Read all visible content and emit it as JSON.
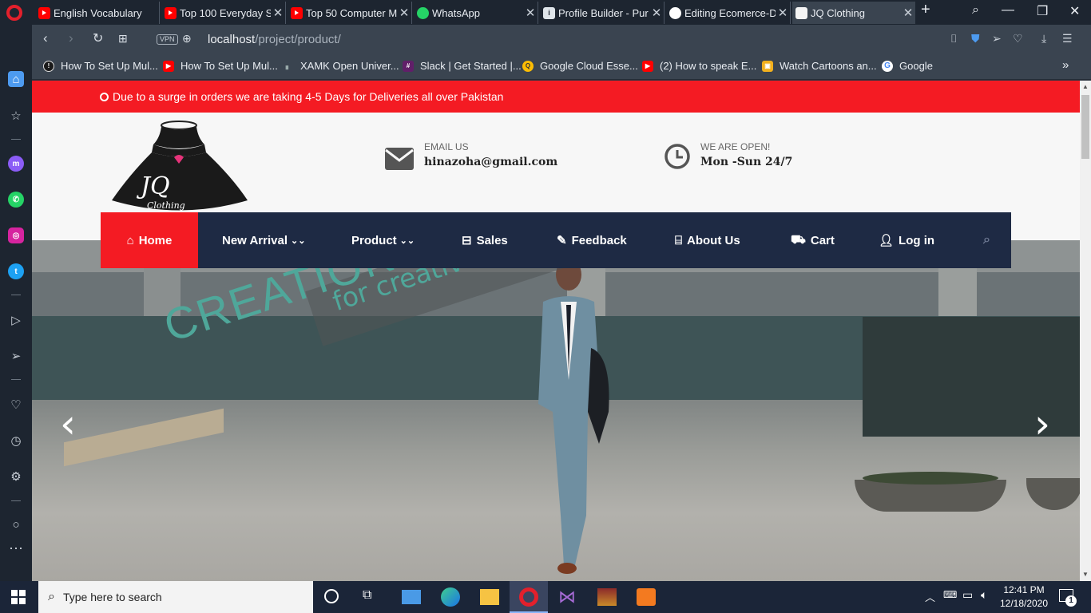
{
  "browser": {
    "tabs": [
      {
        "title": "English Vocabulary",
        "favicon": "youtube-icon"
      },
      {
        "title": "Top 100 Everyday S",
        "favicon": "youtube-icon"
      },
      {
        "title": "Top 50 Computer M",
        "favicon": "youtube-icon"
      },
      {
        "title": "WhatsApp",
        "favicon": "whatsapp-icon"
      },
      {
        "title": "Profile Builder - Pur",
        "favicon": "profile-builder-icon"
      },
      {
        "title": "Editing Ecomerce-D",
        "favicon": "github-icon"
      },
      {
        "title": "JQ Clothing",
        "favicon": "jq-icon",
        "active": true
      }
    ],
    "url_host": "localhost",
    "url_path": "/project/product/",
    "vpn_label": "VPN",
    "bookmarks": [
      {
        "label": "How To Set Up Mul...",
        "color": "#1a1a1a"
      },
      {
        "label": "How To Set Up Mul...",
        "color": "#ff0000"
      },
      {
        "label": "XAMK Open Univer...",
        "color": "#3a4450"
      },
      {
        "label": "Slack | Get Started |...",
        "color": "#611f69"
      },
      {
        "label": "Google Cloud Esse...",
        "color": "#fbbc04"
      },
      {
        "label": "(2) How to speak E...",
        "color": "#ff0000"
      },
      {
        "label": "Watch Cartoons an...",
        "color": "#f2b01e"
      },
      {
        "label": "Google",
        "color": "#ffffff"
      }
    ]
  },
  "site": {
    "notice": "Due to a surge in orders we are taking 4-5 Days for Deliveries all over Pakistan",
    "logo_text": "JQ",
    "logo_sub": "Clothing",
    "email_label": "EMAIL US",
    "email_value": "hinazoha@gmail.com",
    "hours_label": "WE ARE OPEN!",
    "hours_value": "Mon -Sun 24/7",
    "nav": [
      {
        "label": "Home",
        "icon": "home-icon"
      },
      {
        "label": "New Arrival",
        "icon": "chevron-down-icon"
      },
      {
        "label": "Product",
        "icon": "chevron-down-icon"
      },
      {
        "label": "Sales",
        "icon": "basket-icon"
      },
      {
        "label": "Feedback",
        "icon": "edit-icon"
      },
      {
        "label": "About Us",
        "icon": "building-icon"
      },
      {
        "label": "Cart",
        "icon": "cart-icon"
      },
      {
        "label": "Log in",
        "icon": "user-icon"
      }
    ],
    "hero": {
      "headline": "CREATION",
      "tagline": "for creative people",
      "accent_color": "#4fa79a"
    },
    "colors": {
      "notice": "#f41b23",
      "nav": "#1e2a44",
      "home_active": "#f41b23"
    }
  },
  "taskbar": {
    "search_placeholder": "Type here to search",
    "time": "12:41 PM",
    "date": "12/18/2020",
    "notification_count": "1"
  }
}
